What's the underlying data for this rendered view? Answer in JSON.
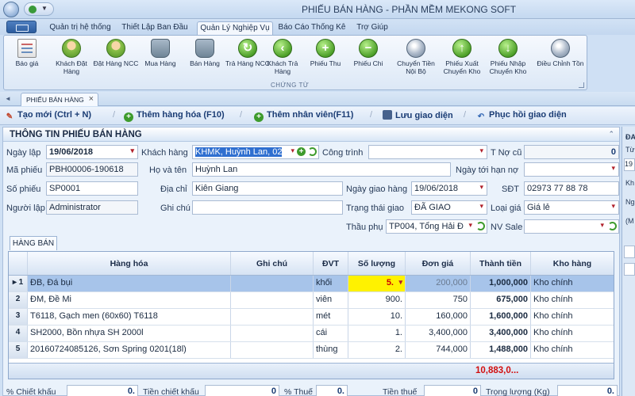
{
  "window": {
    "title": "PHIẾU BÁN HÀNG - PHẦN MỀM MEKONG SOFT"
  },
  "menu_tabs": [
    {
      "label": "Quản trị hệ thống"
    },
    {
      "label": "Thiết Lập Ban Đầu"
    },
    {
      "label": "Quản Lý Nghiệp Vụ"
    },
    {
      "label": "Báo Cáo Thống Kê"
    },
    {
      "label": "Trợ Giúp"
    }
  ],
  "ribbon": {
    "group_label": "CHỨNG TỪ",
    "buttons": [
      {
        "label": "Báo giá",
        "icon": "document-icon"
      },
      {
        "label": "Khách Đặt Hàng",
        "icon": "customer-order-icon"
      },
      {
        "label": "Đặt Hàng NCC",
        "icon": "supplier-order-icon"
      },
      {
        "label": "Mua Hàng",
        "icon": "purchase-icon"
      },
      {
        "label": "Bán Hàng",
        "icon": "sell-icon"
      },
      {
        "label": "Trả Hàng NCC",
        "icon": "return-supplier-icon"
      },
      {
        "label": "Khách Trả Hàng",
        "icon": "customer-return-icon"
      },
      {
        "label": "Phiếu Thu",
        "icon": "plus-circle-icon"
      },
      {
        "label": "Phiếu Chi",
        "icon": "minus-circle-icon"
      },
      {
        "label": "Chuyển Tiền Nội Bộ",
        "icon": "coins-icon"
      },
      {
        "label": "Phiếu Xuất Chuyển Kho",
        "icon": "arrow-up-icon"
      },
      {
        "label": "Phiếu Nhập Chuyển Kho",
        "icon": "arrow-down-icon"
      },
      {
        "label": "Điều Chỉnh Tồn",
        "icon": "adjust-stock-icon"
      }
    ]
  },
  "doc_tab": {
    "label": "PHIẾU BÁN HÀNG"
  },
  "toolbar": {
    "new_label": "Tạo mới (Ctrl + N)",
    "add_product_label": "Thêm hàng hóa (F10)",
    "add_staff_label": "Thêm nhân viên(F11)",
    "save_layout_label": "Lưu giao diện",
    "restore_layout_label": "Phục hồi giao diện"
  },
  "form": {
    "section_title": "THÔNG TIN PHIẾU BÁN HÀNG",
    "labels": {
      "ngay_lap": "Ngày lập",
      "khach_hang": "Khách hàng",
      "cong_trinh": "Công trình",
      "t_no_cu": "T Nợ cũ",
      "ma_phieu": "Mã phiếu",
      "ho_va_ten": "Họ và tên",
      "ngay_toi_han_no": "Ngày tới hạn nợ",
      "so_phieu": "Số phiếu",
      "dia_chi": "Địa chỉ",
      "ngay_giao_hang": "Ngày giao hàng",
      "sdt": "SĐT",
      "nguoi_lap": "Người lập",
      "ghi_chu": "Ghi chú",
      "trang_thai_giao": "Trạng thái giao",
      "loai_gia": "Loại giá",
      "thau_phu": "Thầu phụ",
      "nv_sale": "NV Sale"
    },
    "values": {
      "ngay_lap": "19/06/2018",
      "khach_hang": "KHMK, Huỳnh Lan, 02",
      "cong_trinh": "",
      "t_no_cu": "0",
      "ma_phieu": "PBH00006-190618",
      "ho_va_ten": "Huỳnh Lan",
      "ngay_toi_han_no": "",
      "so_phieu": "SP0001",
      "dia_chi": "Kiên Giang",
      "ngay_giao_hang": "19/06/2018",
      "sdt": "02973 77 88 78",
      "nguoi_lap": "Administrator",
      "ghi_chu": "",
      "trang_thai_giao": "ĐÃ GIAO",
      "loai_gia": "Giá lẻ",
      "thau_phu": "TP004, Tổng Hải Đ",
      "nv_sale": ""
    }
  },
  "detail_tab": {
    "label": "HÀNG BÁN"
  },
  "grid": {
    "columns": [
      "Hàng hóa",
      "Ghi chú",
      "ĐVT",
      "Số lượng",
      "Đơn giá",
      "Thành tiền",
      "Kho hàng"
    ],
    "rows": [
      {
        "idx": "1",
        "item": "ĐB, Đá bụi",
        "note": "",
        "unit": "khối",
        "qty": "5.",
        "price": "200,000",
        "amount": "1,000,000",
        "store": "Kho chính"
      },
      {
        "idx": "2",
        "item": "ĐM, Đề Mi",
        "note": "",
        "unit": "viên",
        "qty": "900.",
        "price": "750",
        "amount": "675,000",
        "store": "Kho chính"
      },
      {
        "idx": "3",
        "item": "T6118, Gạch men (60x60) T6118",
        "note": "",
        "unit": "mét",
        "qty": "10.",
        "price": "160,000",
        "amount": "1,600,000",
        "store": "Kho chính"
      },
      {
        "idx": "4",
        "item": "SH2000, Bồn nhựa SH 2000l",
        "note": "",
        "unit": "cái",
        "qty": "1.",
        "price": "3,400,000",
        "amount": "3,400,000",
        "store": "Kho chính"
      },
      {
        "idx": "5",
        "item": "20160724085126, Sơn Spring 0201(18l)",
        "note": "",
        "unit": "thùng",
        "qty": "2.",
        "price": "744,000",
        "amount": "1,488,000",
        "store": "Kho chính"
      }
    ],
    "total": "10,883,0..."
  },
  "summary": {
    "chiet_khau_label": "% Chiết khấu",
    "chiet_khau_value": "0.",
    "tien_chiet_khau_label": "Tiền chiết khấu",
    "tien_chiet_khau_value": "0",
    "thue_label": "% Thuế",
    "thue_value": "0.",
    "tien_thue_label": "Tiền thuế",
    "tien_thue_value": "0",
    "trong_luong_label": "Trọng lượng (Kg)",
    "trong_luong_value": "0."
  },
  "side_panel": {
    "label_1": "ĐA",
    "label_2": "Từ",
    "label_3": "19",
    "label_4": "Kh",
    "label_5": "Ng",
    "label_6": "(M"
  },
  "colors": {
    "accent": "#3d9b2c",
    "total_text": "#d10f0f",
    "selected_row": "#a7c4ea",
    "highlight_cell": "#fff200"
  }
}
